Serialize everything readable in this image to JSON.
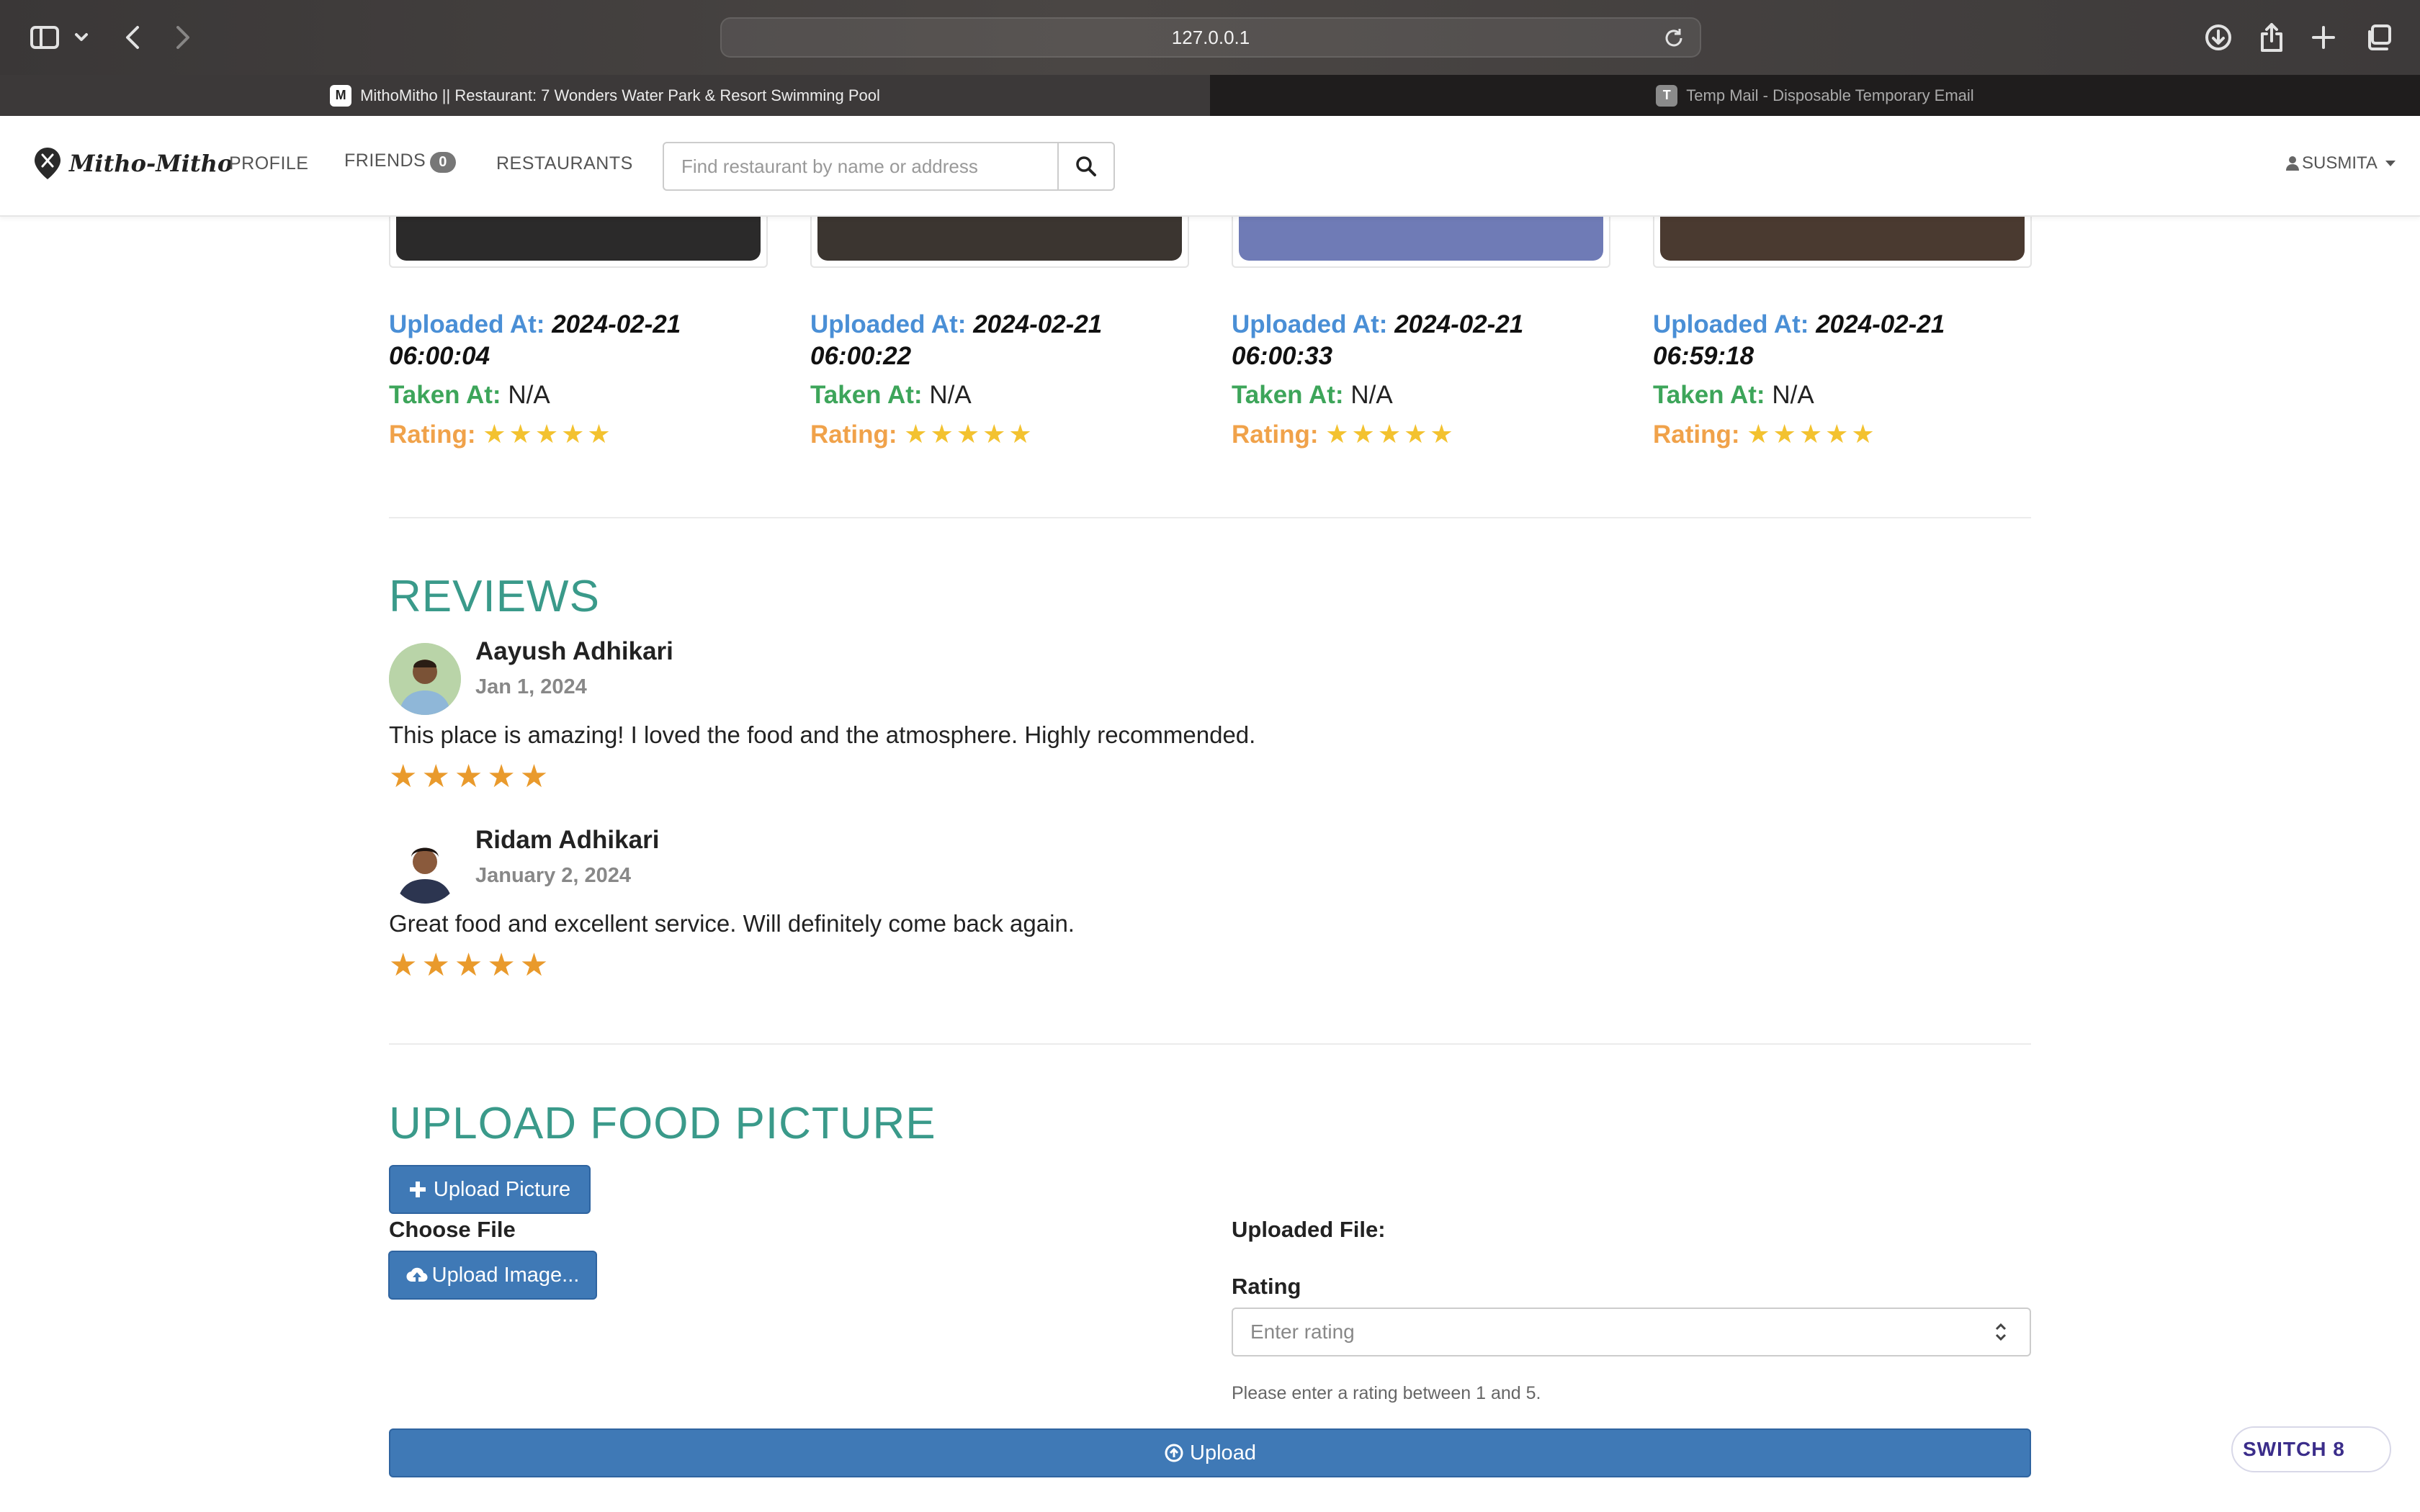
{
  "browser": {
    "url": "127.0.0.1",
    "tabs": [
      {
        "title": "MithoMitho || Restaurant: 7 Wonders Water Park & Resort Swimming Pool",
        "favicon": "M"
      },
      {
        "title": "Temp Mail - Disposable Temporary Email",
        "favicon": "T"
      }
    ]
  },
  "navbar": {
    "brand": "Mitho-Mitho",
    "profile": "PROFILE",
    "friends": "FRIENDS",
    "friends_count": "0",
    "restaurants": "RESTAURANTS",
    "search_placeholder": "Find restaurant by name or address",
    "user": "SUSMITA"
  },
  "photos": [
    {
      "uploaded_label": "Uploaded At:",
      "uploaded": "2024-02-21 06:00:04",
      "taken_label": "Taken At:",
      "taken": "N/A",
      "rating_label": "Rating:",
      "rating": 5,
      "stars": "★★★★★",
      "color": "#2b2a2a"
    },
    {
      "uploaded_label": "Uploaded At:",
      "uploaded": "2024-02-21 06:00:22",
      "taken_label": "Taken At:",
      "taken": "N/A",
      "rating_label": "Rating:",
      "rating": 5,
      "stars": "★★★★★",
      "color": "#3b3530"
    },
    {
      "uploaded_label": "Uploaded At:",
      "uploaded": "2024-02-21 06:00:33",
      "taken_label": "Taken At:",
      "taken": "N/A",
      "rating_label": "Rating:",
      "rating": 5,
      "stars": "★★★★★",
      "color": "#6f7bb6"
    },
    {
      "uploaded_label": "Uploaded At:",
      "uploaded": "2024-02-21 06:59:18",
      "taken_label": "Taken At:",
      "taken": "N/A",
      "rating_label": "Rating:",
      "rating": 5,
      "stars": "★★★★★",
      "color": "#4a3a30"
    }
  ],
  "reviews": {
    "title": "REVIEWS",
    "items": [
      {
        "name": "Aayush Adhikari",
        "date": "Jan 1, 2024",
        "text": "This place is amazing! I loved the food and the atmosphere. Highly recommended.",
        "rating": 5,
        "stars": "★★★★★"
      },
      {
        "name": "Ridam Adhikari",
        "date": "January 2, 2024",
        "text": "Great food and excellent service. Will definitely come back again.",
        "rating": 5,
        "stars": "★★★★★"
      }
    ]
  },
  "upload": {
    "title": "UPLOAD FOOD PICTURE",
    "upload_picture_button": "Upload Picture",
    "choose_file_label": "Choose File",
    "upload_image_button": "Upload Image...",
    "uploaded_file_label": "Uploaded File:",
    "rating_label": "Rating",
    "rating_placeholder": "Enter rating",
    "help_text": "Please enter a rating between 1 and 5.",
    "submit_button": "Upload"
  },
  "switch_badge": "SWITCH 8",
  "colors": {
    "accent_teal": "#3a9a8a",
    "primary_blue": "#3f79b6",
    "label_blue": "#4a8fd6",
    "label_green": "#3da55a",
    "label_orange": "#f0a24a",
    "star_yellow": "#f3c230",
    "star_orange": "#e99a2c"
  }
}
